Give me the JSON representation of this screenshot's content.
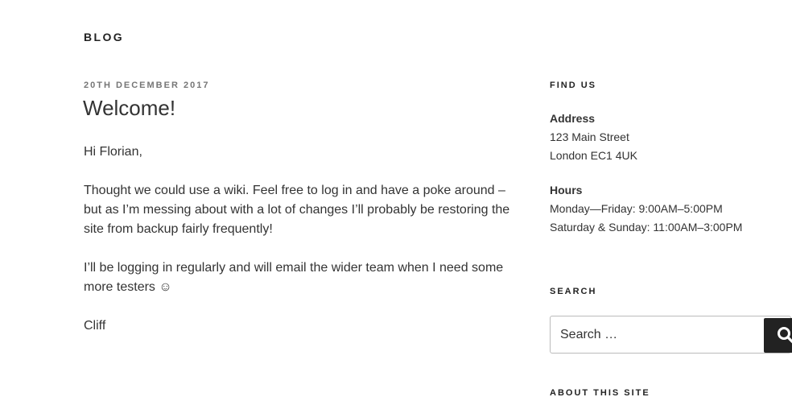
{
  "site": {
    "title": "BLOG"
  },
  "post": {
    "date": "20TH DECEMBER 2017",
    "title": "Welcome!",
    "paragraphs": [
      "Hi Florian,",
      "Thought we could use a wiki.  Feel free to log in and have a poke around – but as I’m messing about with a lot of changes I’ll probably be restoring the site from backup fairly frequently!",
      "I’ll be logging in regularly and will email the wider team when I need some more testers ☺",
      "Cliff"
    ]
  },
  "sidebar": {
    "find_us": {
      "title": "FIND US",
      "address_label": "Address",
      "address_lines": [
        "123 Main Street",
        "London EC1 4UK"
      ],
      "hours_label": "Hours",
      "hours_lines": [
        "Monday—Friday: 9:00AM–5:00PM",
        "Saturday & Sunday: 11:00AM–3:00PM"
      ]
    },
    "search": {
      "title": "SEARCH",
      "placeholder": "Search …",
      "button_icon": "search-icon"
    },
    "about": {
      "title": "ABOUT THIS SITE"
    }
  }
}
